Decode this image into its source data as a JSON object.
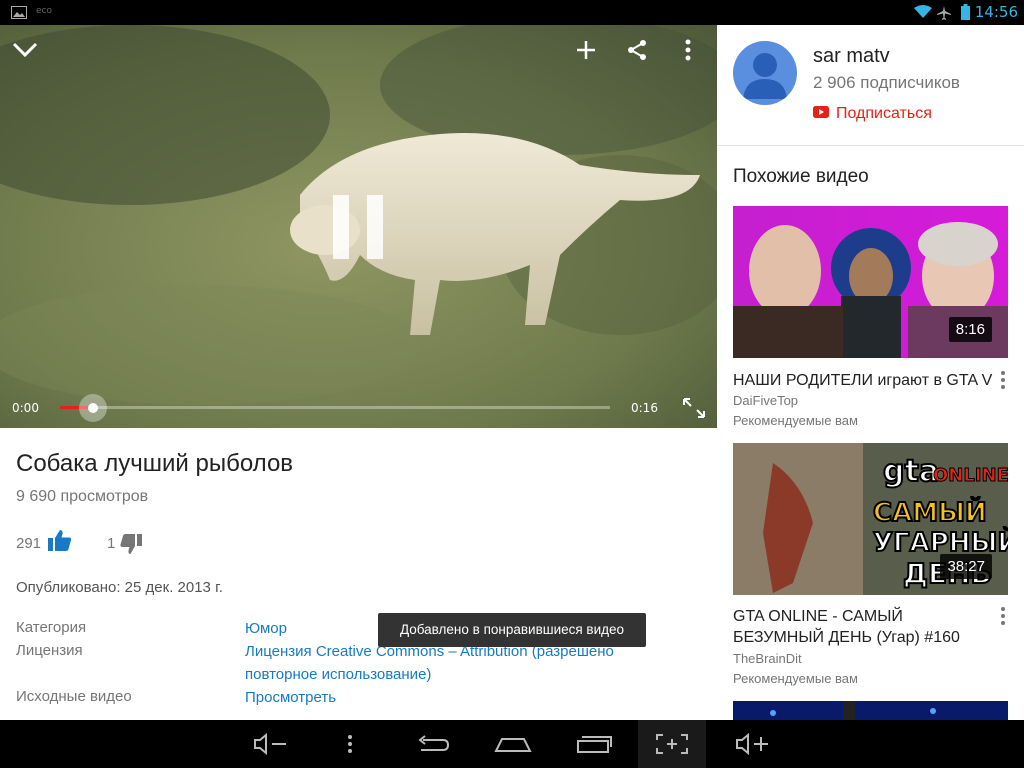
{
  "status_bar": {
    "eco_label": "eco",
    "time": "14:56"
  },
  "player": {
    "current_time": "0:00",
    "total_time": "0:16",
    "progress_fraction": 0.06,
    "accent_color": "#e62117"
  },
  "video": {
    "title": "Собака лучший рыболов",
    "views": "9 690 просмотров",
    "likes": "291",
    "dislikes": "1",
    "published": "Опубликовано: 25 дек. 2013 г.",
    "meta": {
      "category_label": "Категория",
      "category_value": "Юмор",
      "license_label": "Лицензия",
      "license_value": "Лицензия Creative Commons – Attribution (разрешено повторное использование)",
      "source_label": "Исходные видео",
      "source_value": "Просмотреть"
    }
  },
  "toast": {
    "text": "Добавлено в понравившиеся видео"
  },
  "channel": {
    "name": "sar matv",
    "subscribers": "2 906 подписчиков",
    "subscribe_label": "Подписаться"
  },
  "related": {
    "heading": "Похожие видео",
    "items": [
      {
        "title": "НАШИ РОДИТЕЛИ играют в GTA V",
        "channel": "DaiFiveTop",
        "reco": "Рекомендуемые вам",
        "duration": "8:16"
      },
      {
        "title": "GTA ONLINE - САМЫЙ БЕЗУМНЫЙ ДЕНЬ (Угар) #160",
        "channel": "TheBrainDit",
        "reco": "Рекомендуемые вам",
        "duration": "38:27",
        "thumb_text": [
          "gta",
          "ONLINE",
          "САМЫЙ",
          "УГАРНЫЙ",
          "ДЕНЬ"
        ]
      }
    ]
  }
}
